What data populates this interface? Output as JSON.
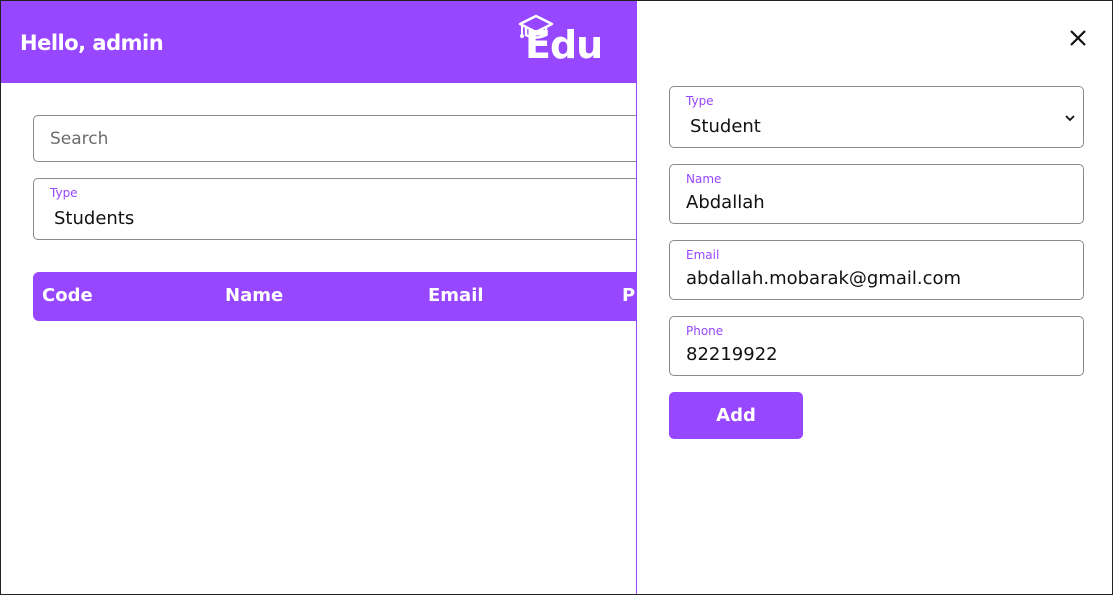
{
  "header": {
    "greeting": "Hello, admin",
    "logo_text": "Edu",
    "brand_color": "#9747ff"
  },
  "search": {
    "placeholder": "Search",
    "value": ""
  },
  "filter": {
    "label": "Type",
    "value": "Students"
  },
  "table": {
    "columns": [
      "Code",
      "Name",
      "Email",
      "Ph"
    ]
  },
  "drawer": {
    "close_icon": "close-icon",
    "type": {
      "label": "Type",
      "value": "Student"
    },
    "name": {
      "label": "Name",
      "value": "Abdallah"
    },
    "email": {
      "label": "Email",
      "value": "abdallah.mobarak@gmail.com"
    },
    "phone": {
      "label": "Phone",
      "value": "82219922"
    },
    "add_label": "Add"
  }
}
